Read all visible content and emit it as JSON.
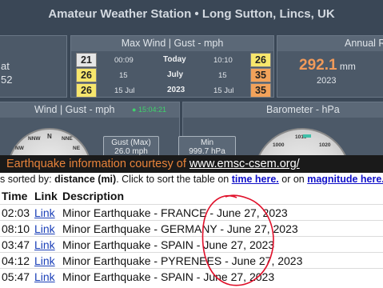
{
  "dashboard": {
    "title": "Amateur Weather Station  •  Long Sutton, Lincs, UK",
    "left_panel": {
      "line1": "at",
      "line2": "52"
    },
    "max_wind": {
      "header": "Max Wind | Gust - mph",
      "today_label": "Today",
      "month_label": "July",
      "year_label": "2023",
      "rows": [
        {
          "left_box": "21",
          "left_time": "00:09",
          "right_time": "10:10",
          "right_box": "26"
        },
        {
          "left_box": "26",
          "left_time": "15",
          "right_time": "15",
          "right_box": "35"
        },
        {
          "left_box": "26",
          "left_time": "15 Jul",
          "right_time": "15 Jul",
          "right_box": "35"
        }
      ]
    },
    "annual": {
      "header": "Annual R",
      "value": "292.1",
      "unit": "mm",
      "year": "2023"
    },
    "wind_panel": {
      "header": "Wind | Gust - mph",
      "time": "15:04:21",
      "compass": [
        "NNW",
        "N",
        "NNE",
        "NW",
        "NE"
      ],
      "gust_box": {
        "label": "Gust (Max)",
        "value": "26.0 mph"
      }
    },
    "barometer": {
      "header": "Barometer - hPa",
      "min_box": {
        "label": "Min",
        "value": "999.7 hPa"
      },
      "ticks": [
        "1000",
        "1010",
        "1020"
      ]
    }
  },
  "banner": {
    "prefix": "Earthquake information courtesy of ",
    "link": "www.emsc-csem.org/"
  },
  "sort_line": {
    "prefix": "s sorted by: ",
    "field": "distance (mi)",
    "middle": ".   Click to sort the table on ",
    "time_link": "time here.",
    "or_text": " or on ",
    "mag_link": "magnitude here."
  },
  "table": {
    "headers": [
      "Time",
      "Link",
      "Description"
    ],
    "rows": [
      {
        "time": "02:03",
        "link": "Link",
        "desc": "Minor Earthquake - FRANCE - June 27, 2023"
      },
      {
        "time": "08:10",
        "link": "Link",
        "desc": "Minor Earthquake - GERMANY - June 27, 2023"
      },
      {
        "time": "03:47",
        "link": "Link",
        "desc": "Minor Earthquake - SPAIN - June 27, 2023"
      },
      {
        "time": "04:12",
        "link": "Link",
        "desc": "Minor Earthquake - PYRENEES - June 27, 2023"
      },
      {
        "time": "05:47",
        "link": "Link",
        "desc": "Minor Earthquake - SPAIN - June 27, 2023"
      }
    ]
  },
  "annotation_color": "#e0102a"
}
